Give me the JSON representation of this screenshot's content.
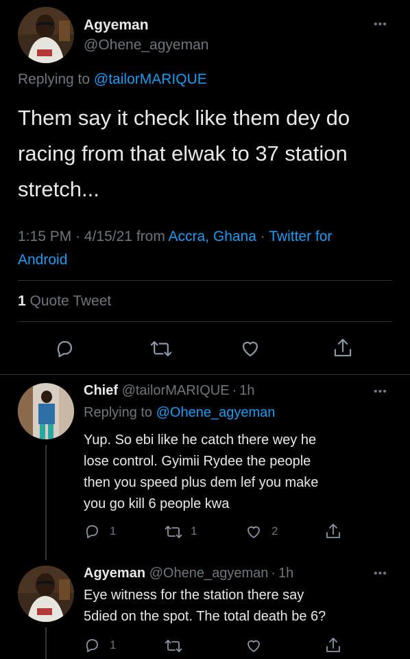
{
  "main_tweet": {
    "display_name": "Agyeman",
    "handle": "@Ohene_agyeman",
    "replying_prefix": "Replying to",
    "replying_to": "@tailorMARIQUE",
    "text_line1": "Them say it check like them dey do",
    "text_line2": "racing from that elwak to 37 station",
    "text_line3": "stretch...",
    "time": "1:15 PM",
    "sep1": "·",
    "date": "4/15/21",
    "from_word": "from",
    "location": "Accra, Ghana",
    "sep2": "·",
    "client_part1": "Twitter for",
    "client_part2": "Android",
    "quote_count": "1",
    "quote_label": "Quote Tweet"
  },
  "replies": [
    {
      "display_name": "Chief",
      "handle": "@tailorMARIQUE",
      "sep": "·",
      "time": "1h",
      "replying_prefix": "Replying to",
      "replying_to": "@Ohene_agyeman",
      "text_lines": [
        "Yup. So ebi like he catch there wey he",
        "lose control. Gyimii Rydee the people",
        "then you speed plus dem lef you make",
        "you go kill 6 people kwa"
      ],
      "reply_count": "1",
      "retweet_count": "1",
      "like_count": "2"
    },
    {
      "display_name": "Agyeman",
      "handle": "@Ohene_agyeman",
      "sep": "·",
      "time": "1h",
      "text_lines": [
        "Eye witness for the station there say",
        "5died on the spot. The total death be 6?"
      ],
      "reply_count": "1"
    }
  ],
  "icons": {
    "more": "more-icon",
    "reply": "reply-icon",
    "retweet": "retweet-icon",
    "like": "like-icon",
    "share": "share-icon"
  },
  "colors": {
    "background": "#000000",
    "text": "#d9d9d9",
    "secondary": "#6e767d",
    "link": "#1d9bf0",
    "divider": "#2f3336"
  }
}
